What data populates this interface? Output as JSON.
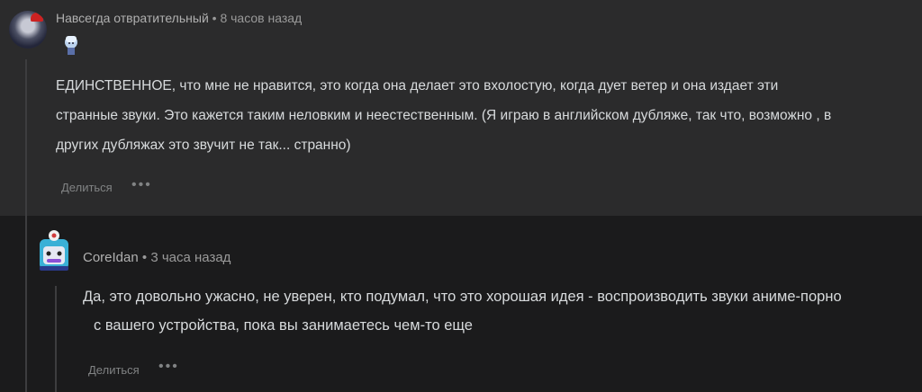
{
  "parent_comment": {
    "author": "Навсегда отвратительный",
    "separator": " • ",
    "time": "8 часов назад",
    "lines": [
      "ЕДИНСТВЕННОЕ, что мне не нравится, это когда она делает это вхолостую, когда дует ветер и она издает эти",
      "странные звуки. Это кажется таким неловким и неестественным. (Я играю в английском дубляже, так что, возможно , в",
      "других дубляжах это звучит не так... странно)"
    ],
    "share_label": "Делиться",
    "more_label": "•••"
  },
  "reply_comment": {
    "author": "CoreIdan",
    "separator": " • ",
    "time": "3 часа назад",
    "lines": [
      "Да, это довольно ужасно, не уверен, кто подумал, что это хорошая идея - воспроизводить звуки аниме-порно",
      "с вашего устройства, пока вы занимаетесь чем-то еще"
    ],
    "share_label": "Делиться",
    "more_label": "•••"
  },
  "colors": {
    "background": "#1b1b1c",
    "top_comment_bg": "#2b2b2c",
    "text": "#d7dadc",
    "meta": "#9a9a9a"
  }
}
